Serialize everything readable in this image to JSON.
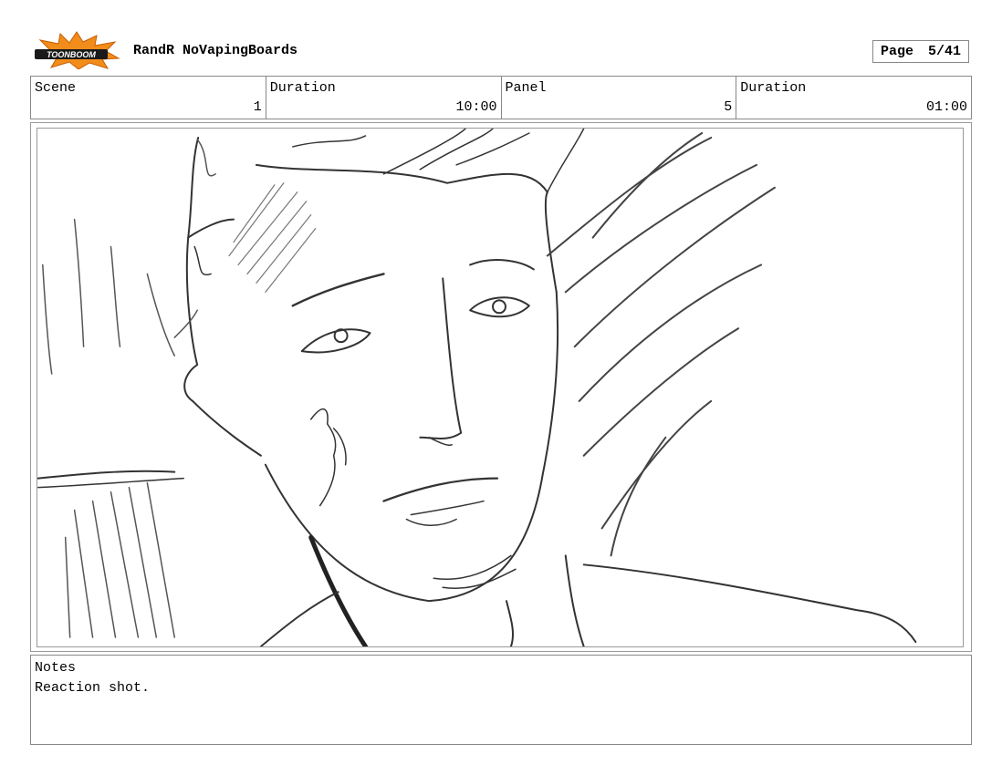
{
  "header": {
    "logo_text": "TOONBOOM",
    "project_title": "RandR NoVapingBoards",
    "page_label": "Page",
    "page_value": "5/41"
  },
  "info": {
    "scene_label": "Scene",
    "scene_value": "1",
    "duration_label": "Duration",
    "duration_value": "10:00",
    "panel_label": "Panel",
    "panel_value": "5",
    "panel_duration_label": "Duration",
    "panel_duration_value": "01:00"
  },
  "panel": {
    "image": "pencil-sketch-reaction-closeup"
  },
  "notes": {
    "label": "Notes",
    "text": "Reaction shot."
  },
  "colors": {
    "border": "#888888",
    "logo_burst": "#f28c1a",
    "logo_band": "#1a1a1a"
  }
}
